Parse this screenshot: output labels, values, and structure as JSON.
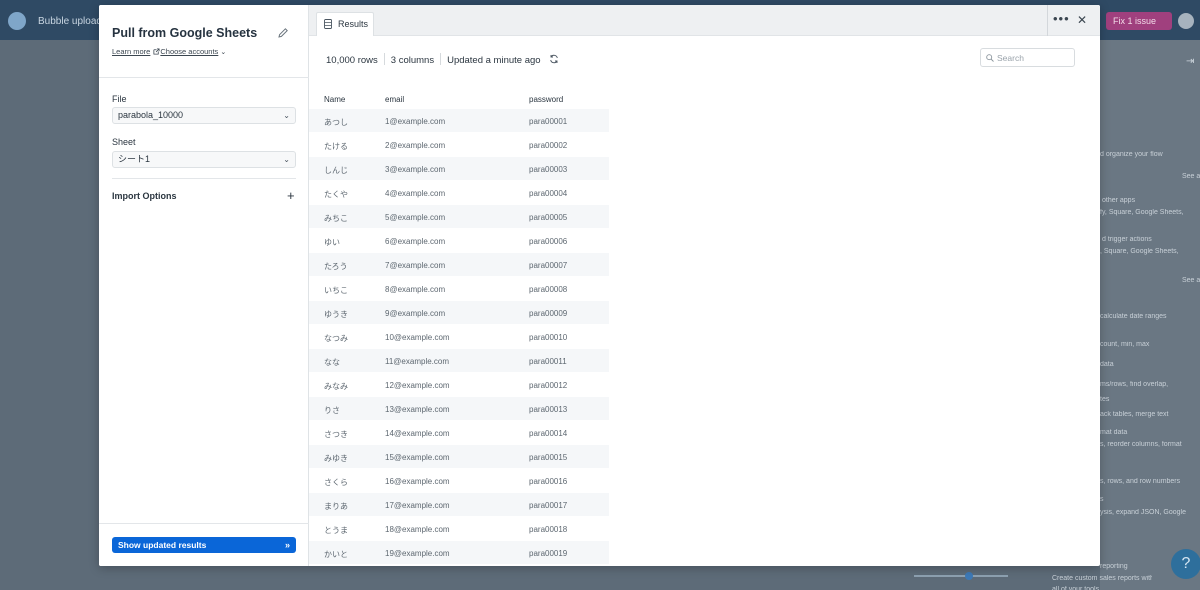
{
  "background": {
    "app_title": "Bubble upload",
    "fix_issue_label": "Fix 1 issue",
    "sidebar_lines": [
      "d organize your flow",
      "See a",
      "other apps",
      "fy, Square, Google Sheets,",
      "d trigger actions",
      ", Square, Google Sheets,",
      "See a",
      "calculate date ranges",
      "count, min, max",
      "data",
      "ms/rows, find overlap,",
      "tes",
      "ack tables, merge text",
      "mat data",
      "s, reorder columns, format",
      "s, rows, and row numbers",
      "s",
      "ysis, expand JSON, Google",
      "reporting",
      "Create custom sales reports with da",
      "all of your tools"
    ],
    "help_label": "?"
  },
  "left_panel": {
    "title": "Pull from Google Sheets",
    "learn_more": "Learn more",
    "choose_accounts": "Choose accounts",
    "file_label": "File",
    "file_value": "parabola_10000",
    "sheet_label": "Sheet",
    "sheet_value": "シート1",
    "import_options": "Import Options",
    "show_results_button": "Show updated results"
  },
  "results_panel": {
    "tab_label": "Results",
    "rows_count": "10,000 rows",
    "columns_count": "3 columns",
    "updated": "Updated a minute ago",
    "search_placeholder": "Search",
    "columns": [
      "Name",
      "email",
      "password"
    ],
    "rows": [
      [
        "あつし",
        "1@example.com",
        "para00001"
      ],
      [
        "たける",
        "2@example.com",
        "para00002"
      ],
      [
        "しんじ",
        "3@example.com",
        "para00003"
      ],
      [
        "たくや",
        "4@example.com",
        "para00004"
      ],
      [
        "みちこ",
        "5@example.com",
        "para00005"
      ],
      [
        "ゆい",
        "6@example.com",
        "para00006"
      ],
      [
        "たろう",
        "7@example.com",
        "para00007"
      ],
      [
        "いちこ",
        "8@example.com",
        "para00008"
      ],
      [
        "ゆうき",
        "9@example.com",
        "para00009"
      ],
      [
        "なつみ",
        "10@example.com",
        "para00010"
      ],
      [
        "なな",
        "11@example.com",
        "para00011"
      ],
      [
        "みなみ",
        "12@example.com",
        "para00012"
      ],
      [
        "りさ",
        "13@example.com",
        "para00013"
      ],
      [
        "さつき",
        "14@example.com",
        "para00014"
      ],
      [
        "みゆき",
        "15@example.com",
        "para00015"
      ],
      [
        "さくら",
        "16@example.com",
        "para00016"
      ],
      [
        "まりあ",
        "17@example.com",
        "para00017"
      ],
      [
        "とうま",
        "18@example.com",
        "para00018"
      ],
      [
        "かいと",
        "19@example.com",
        "para00019"
      ]
    ]
  }
}
